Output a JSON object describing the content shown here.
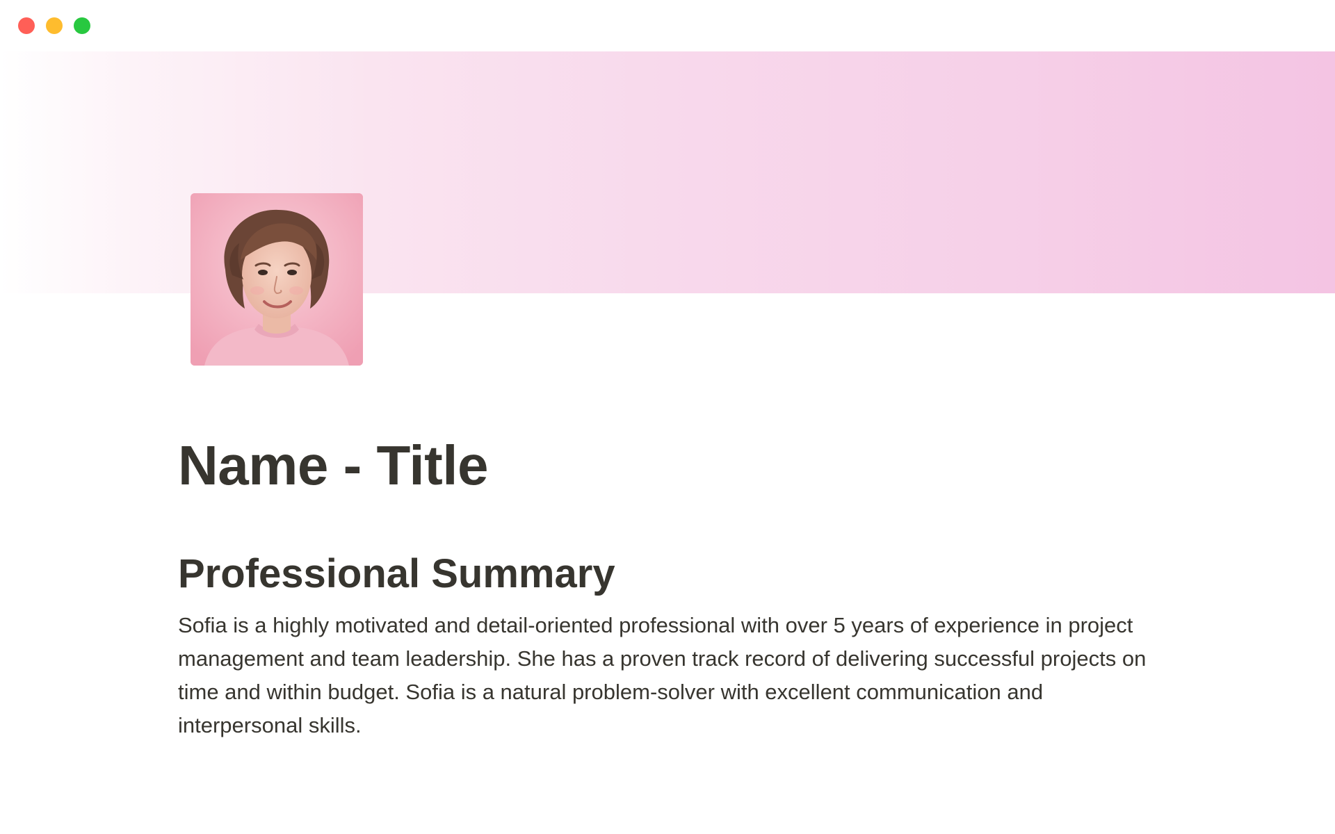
{
  "window": {
    "controls": [
      "close",
      "minimize",
      "zoom"
    ],
    "colors": {
      "close": "#ff5f57",
      "minimize": "#febc2e",
      "zoom": "#28c840"
    }
  },
  "cover": {
    "style": "pink-gradient",
    "colors": [
      "#ffffff",
      "#f4c4e3"
    ]
  },
  "page_icon": {
    "type": "profile-photo",
    "description_icon": "portrait-icon"
  },
  "page": {
    "title": "Name - Title"
  },
  "summary": {
    "heading": "Professional Summary",
    "text": "Sofia is a highly motivated and detail-oriented professional with over 5 years of experience in project management and team leadership. She has a proven track record of delivering successful projects on time and within budget. Sofia is a natural problem-solver with excellent communication and interpersonal skills."
  }
}
